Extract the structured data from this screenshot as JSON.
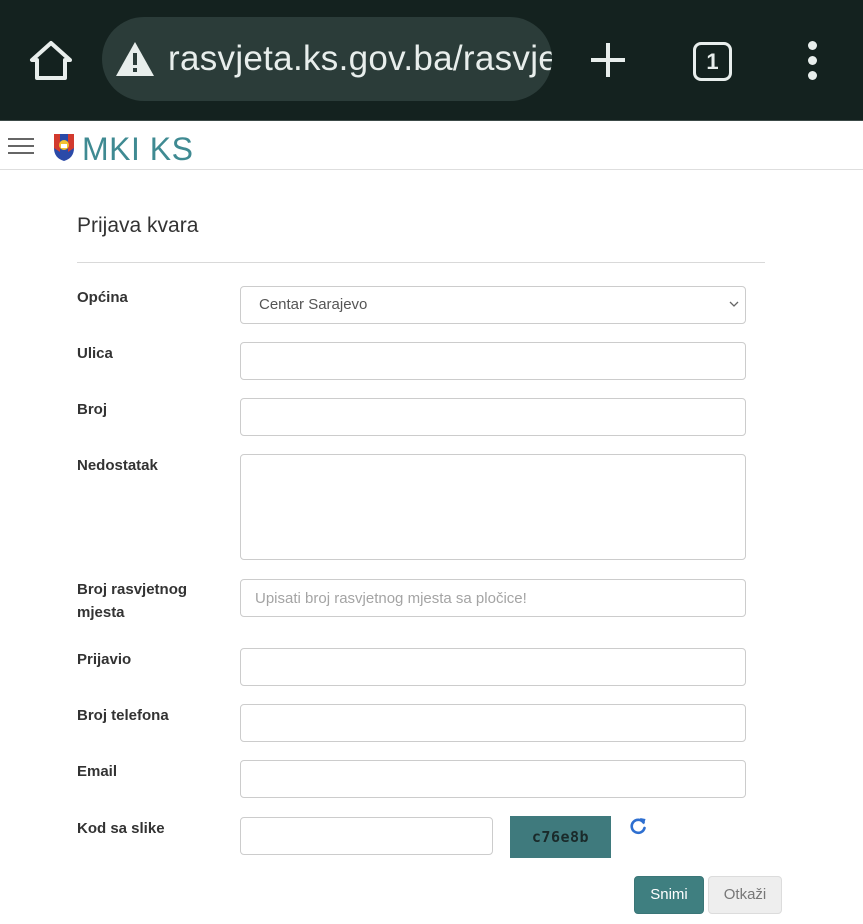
{
  "browser": {
    "url": "rasvjeta.ks.gov.ba/rasvje",
    "tab_count": "1"
  },
  "site": {
    "brand": "MKI KS"
  },
  "form": {
    "title": "Prijava kvara",
    "fields": {
      "opcina": {
        "label": "Općina",
        "value": "Centar Sarajevo"
      },
      "ulica": {
        "label": "Ulica",
        "value": ""
      },
      "broj": {
        "label": "Broj",
        "value": ""
      },
      "nedostatak": {
        "label": "Nedostatak",
        "value": ""
      },
      "broj_rasvjetnog_mjesta": {
        "label": "Broj rasvjetnog mjesta",
        "value": "",
        "placeholder": "Upisati broj rasvjetnog mjesta sa pločice!"
      },
      "prijavio": {
        "label": "Prijavio",
        "value": ""
      },
      "broj_telefona": {
        "label": "Broj telefona",
        "value": ""
      },
      "email": {
        "label": "Email",
        "value": ""
      },
      "kod": {
        "label": "Kod sa slike",
        "value": "",
        "captcha_text": "c76e8b"
      }
    },
    "buttons": {
      "save": "Snimi",
      "cancel": "Otkaži"
    }
  },
  "icons": {
    "home": "home-icon",
    "warning": "warning-icon",
    "new_tab": "plus-icon",
    "tabs": "tab-switcher-icon",
    "menu": "more-vert-icon",
    "hamburger": "hamburger-icon",
    "crest": "crest-icon",
    "select_arrow": "chevron-down-icon",
    "refresh": "refresh-icon"
  },
  "colors": {
    "chrome_bg": "#14221f",
    "urlbar_bg": "#2b3c39",
    "brand": "#3f8a92",
    "primary_button": "#3f7f80",
    "captcha_bg": "#3f7a7d",
    "refresh_icon": "#2e6fd0"
  }
}
